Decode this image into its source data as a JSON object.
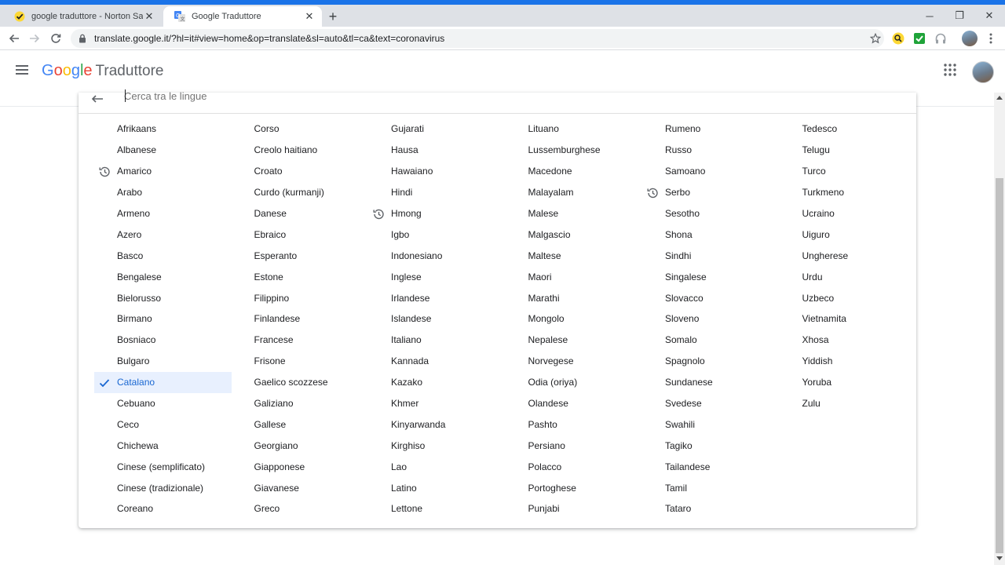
{
  "browser": {
    "tabs": [
      {
        "title": "google traduttore - Norton Safe",
        "active": false
      },
      {
        "title": "Google Traduttore",
        "active": true
      }
    ],
    "new_tab_label": "+",
    "url": "translate.google.it/?hl=it#view=home&op=translate&sl=auto&tl=ca&text=coronavirus",
    "window_controls": {
      "minimize": "─",
      "restore": "❐",
      "close": "✕"
    },
    "extensions": [
      "norton-search-icon",
      "norton-check-icon",
      "headphones-icon"
    ]
  },
  "app": {
    "logo_letters": [
      {
        "char": "G",
        "color": "#4285f4"
      },
      {
        "char": "o",
        "color": "#ea4335"
      },
      {
        "char": "o",
        "color": "#fbbc05"
      },
      {
        "char": "g",
        "color": "#4285f4"
      },
      {
        "char": "l",
        "color": "#34a853"
      },
      {
        "char": "e",
        "color": "#ea4335"
      }
    ],
    "product_name": "Traduttore"
  },
  "language_picker": {
    "search_placeholder": "Cerca tra le lingue",
    "selected": "Catalano",
    "selected_color": "#1967d2",
    "columns": [
      [
        {
          "label": "Afrikaans"
        },
        {
          "label": "Albanese"
        },
        {
          "label": "Amarico",
          "recent": true
        },
        {
          "label": "Arabo"
        },
        {
          "label": "Armeno"
        },
        {
          "label": "Azero"
        },
        {
          "label": "Basco"
        },
        {
          "label": "Bengalese"
        },
        {
          "label": "Bielorusso"
        },
        {
          "label": "Birmano"
        },
        {
          "label": "Bosniaco"
        },
        {
          "label": "Bulgaro"
        },
        {
          "label": "Catalano",
          "selected": true
        },
        {
          "label": "Cebuano"
        },
        {
          "label": "Ceco"
        },
        {
          "label": "Chichewa"
        },
        {
          "label": "Cinese (semplificato)"
        },
        {
          "label": "Cinese (tradizionale)"
        },
        {
          "label": "Coreano"
        }
      ],
      [
        {
          "label": "Corso"
        },
        {
          "label": "Creolo haitiano"
        },
        {
          "label": "Croato"
        },
        {
          "label": "Curdo (kurmanji)"
        },
        {
          "label": "Danese"
        },
        {
          "label": "Ebraico"
        },
        {
          "label": "Esperanto"
        },
        {
          "label": "Estone"
        },
        {
          "label": "Filippino"
        },
        {
          "label": "Finlandese"
        },
        {
          "label": "Francese"
        },
        {
          "label": "Frisone"
        },
        {
          "label": "Gaelico scozzese"
        },
        {
          "label": "Galiziano"
        },
        {
          "label": "Gallese"
        },
        {
          "label": "Georgiano"
        },
        {
          "label": "Giapponese"
        },
        {
          "label": "Giavanese"
        },
        {
          "label": "Greco"
        }
      ],
      [
        {
          "label": "Gujarati"
        },
        {
          "label": "Hausa"
        },
        {
          "label": "Hawaiano"
        },
        {
          "label": "Hindi"
        },
        {
          "label": "Hmong",
          "recent": true
        },
        {
          "label": "Igbo"
        },
        {
          "label": "Indonesiano"
        },
        {
          "label": "Inglese"
        },
        {
          "label": "Irlandese"
        },
        {
          "label": "Islandese"
        },
        {
          "label": "Italiano"
        },
        {
          "label": "Kannada"
        },
        {
          "label": "Kazako"
        },
        {
          "label": "Khmer"
        },
        {
          "label": "Kinyarwanda"
        },
        {
          "label": "Kirghiso"
        },
        {
          "label": "Lao"
        },
        {
          "label": "Latino"
        },
        {
          "label": "Lettone"
        }
      ],
      [
        {
          "label": "Lituano"
        },
        {
          "label": "Lussemburghese"
        },
        {
          "label": "Macedone"
        },
        {
          "label": "Malayalam"
        },
        {
          "label": "Malese"
        },
        {
          "label": "Malgascio"
        },
        {
          "label": "Maltese"
        },
        {
          "label": "Maori"
        },
        {
          "label": "Marathi"
        },
        {
          "label": "Mongolo"
        },
        {
          "label": "Nepalese"
        },
        {
          "label": "Norvegese"
        },
        {
          "label": "Odia (oriya)"
        },
        {
          "label": "Olandese"
        },
        {
          "label": "Pashto"
        },
        {
          "label": "Persiano"
        },
        {
          "label": "Polacco"
        },
        {
          "label": "Portoghese"
        },
        {
          "label": "Punjabi"
        }
      ],
      [
        {
          "label": "Rumeno"
        },
        {
          "label": "Russo"
        },
        {
          "label": "Samoano"
        },
        {
          "label": "Serbo",
          "recent": true
        },
        {
          "label": "Sesotho"
        },
        {
          "label": "Shona"
        },
        {
          "label": "Sindhi"
        },
        {
          "label": "Singalese"
        },
        {
          "label": "Slovacco"
        },
        {
          "label": "Sloveno"
        },
        {
          "label": "Somalo"
        },
        {
          "label": "Spagnolo"
        },
        {
          "label": "Sundanese"
        },
        {
          "label": "Svedese"
        },
        {
          "label": "Swahili"
        },
        {
          "label": "Tagiko"
        },
        {
          "label": "Tailandese"
        },
        {
          "label": "Tamil"
        },
        {
          "label": "Tataro"
        }
      ],
      [
        {
          "label": "Tedesco"
        },
        {
          "label": "Telugu"
        },
        {
          "label": "Turco"
        },
        {
          "label": "Turkmeno"
        },
        {
          "label": "Ucraino"
        },
        {
          "label": "Uiguro"
        },
        {
          "label": "Ungherese"
        },
        {
          "label": "Urdu"
        },
        {
          "label": "Uzbeco"
        },
        {
          "label": "Vietnamita"
        },
        {
          "label": "Xhosa"
        },
        {
          "label": "Yiddish"
        },
        {
          "label": "Yoruba"
        },
        {
          "label": "Zulu"
        }
      ]
    ]
  }
}
